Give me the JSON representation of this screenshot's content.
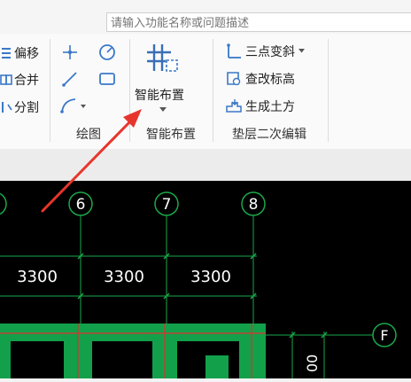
{
  "search": {
    "placeholder": "请输入功能名称或问题描述"
  },
  "ribbon": {
    "edit_items": [
      "偏移",
      "合并",
      "分割"
    ],
    "draw_group_label": "绘图",
    "smart_button_label": "智能布置",
    "smart_group_label": "智能布置",
    "cushion_items": [
      "三点变斜",
      "查改标高",
      "生成土方"
    ],
    "cushion_group_label": "垫层二次编辑"
  },
  "canvas": {
    "axis_labels": [
      "6",
      "7",
      "8"
    ],
    "row_label": "F",
    "dimensions": [
      "3300",
      "3300",
      "3300"
    ],
    "partial_dimension": "00"
  },
  "colors": {
    "background": "#000000",
    "axis_line": "#1aa84a",
    "green_fill": "#13a04a",
    "red_line": "#e03030",
    "arrow": "#e8352b",
    "text": "#ffffff"
  }
}
